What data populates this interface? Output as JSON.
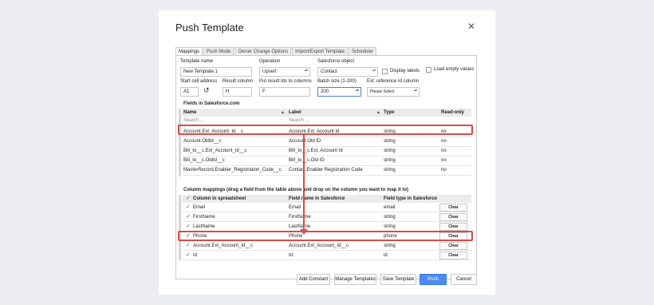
{
  "dialog": {
    "title": "Push Template",
    "close_icon": "close-icon"
  },
  "tabs": [
    {
      "label": "Mappings",
      "active": true
    },
    {
      "label": "Push Mode"
    },
    {
      "label": "Owner Change Options"
    },
    {
      "label": "Import/Export Template"
    },
    {
      "label": "Scheduler"
    }
  ],
  "form": {
    "template_name_label": "Template name",
    "template_name_value": "New Template 1",
    "operation_label": "Operation",
    "operation_value": "Upsert",
    "sf_object_label": "Salesforce object",
    "sf_object_value": "Contact",
    "display_labels": "Display labels",
    "load_empty_values": "Load empty values",
    "start_cell_label": "Start cell address",
    "start_cell_value": "A1",
    "result_column_label": "Result column",
    "result_column_value": "H",
    "put_result_label": "Put result Ids to columns",
    "put_result_value": "F",
    "batch_size_label": "Batch size (1-200)",
    "batch_size_value": "200",
    "ext_ref_label": "Ext. reference Id column",
    "ext_ref_value": "Please Select"
  },
  "fields_section": {
    "title": "Fields in Salesforce.com",
    "headers": [
      "Name",
      "Label",
      "Type",
      "Read-only"
    ],
    "search_placeholder_name": "Search ...",
    "search_placeholder_label": "Search ...",
    "rows": [
      {
        "name": "Account.Ext_Account_Id__c",
        "label": "Account.Ext. Account Id",
        "type": "string",
        "readonly": "no"
      },
      {
        "name": "Account.OldId__c",
        "label": "Account.Old ID",
        "type": "string",
        "readonly": "no"
      },
      {
        "name": "Bill_to__c.Ext_Account_Id__c",
        "label": "Bill_to__c.Ext. Account Id",
        "type": "string",
        "readonly": "no"
      },
      {
        "name": "Bill_to__c.OldId__c",
        "label": "Bill_to__c.Old ID",
        "type": "string",
        "readonly": "no"
      },
      {
        "name": "MasterRecord.Enabler_Registration_Code__c",
        "label": "Contact.Enabler Registration Code",
        "type": "string",
        "readonly": "no"
      }
    ]
  },
  "mappings_section": {
    "title": "Column mappings (drag a field from the table above and drop on the column you want to map it to)",
    "headers": [
      "Column in spreadsheet",
      "Field name in Salesforce",
      "Field type in Salesforce"
    ],
    "clear_label": "Clear",
    "rows": [
      {
        "column": "Email",
        "field": "Email",
        "type": "email"
      },
      {
        "column": "FirstName",
        "field": "FirstName",
        "type": "string"
      },
      {
        "column": "LastName",
        "field": "LastName",
        "type": "string"
      },
      {
        "column": "Phone",
        "field": "Phone",
        "type": "phone"
      },
      {
        "column": "Account.Ext_Account_Id__c",
        "field": "Account.Ext_Account_Id__c",
        "type": "string"
      },
      {
        "column": "Id",
        "field": "Id",
        "type": "id"
      }
    ]
  },
  "footer": {
    "add_constant": "Add Constant",
    "manage_templates": "Manage Templates",
    "save_template": "Save Template",
    "push": "Push",
    "cancel": "Cancel"
  },
  "colors": {
    "highlight": "#d84c47",
    "primary": "#4b8bf4",
    "background": "#eceef3"
  }
}
